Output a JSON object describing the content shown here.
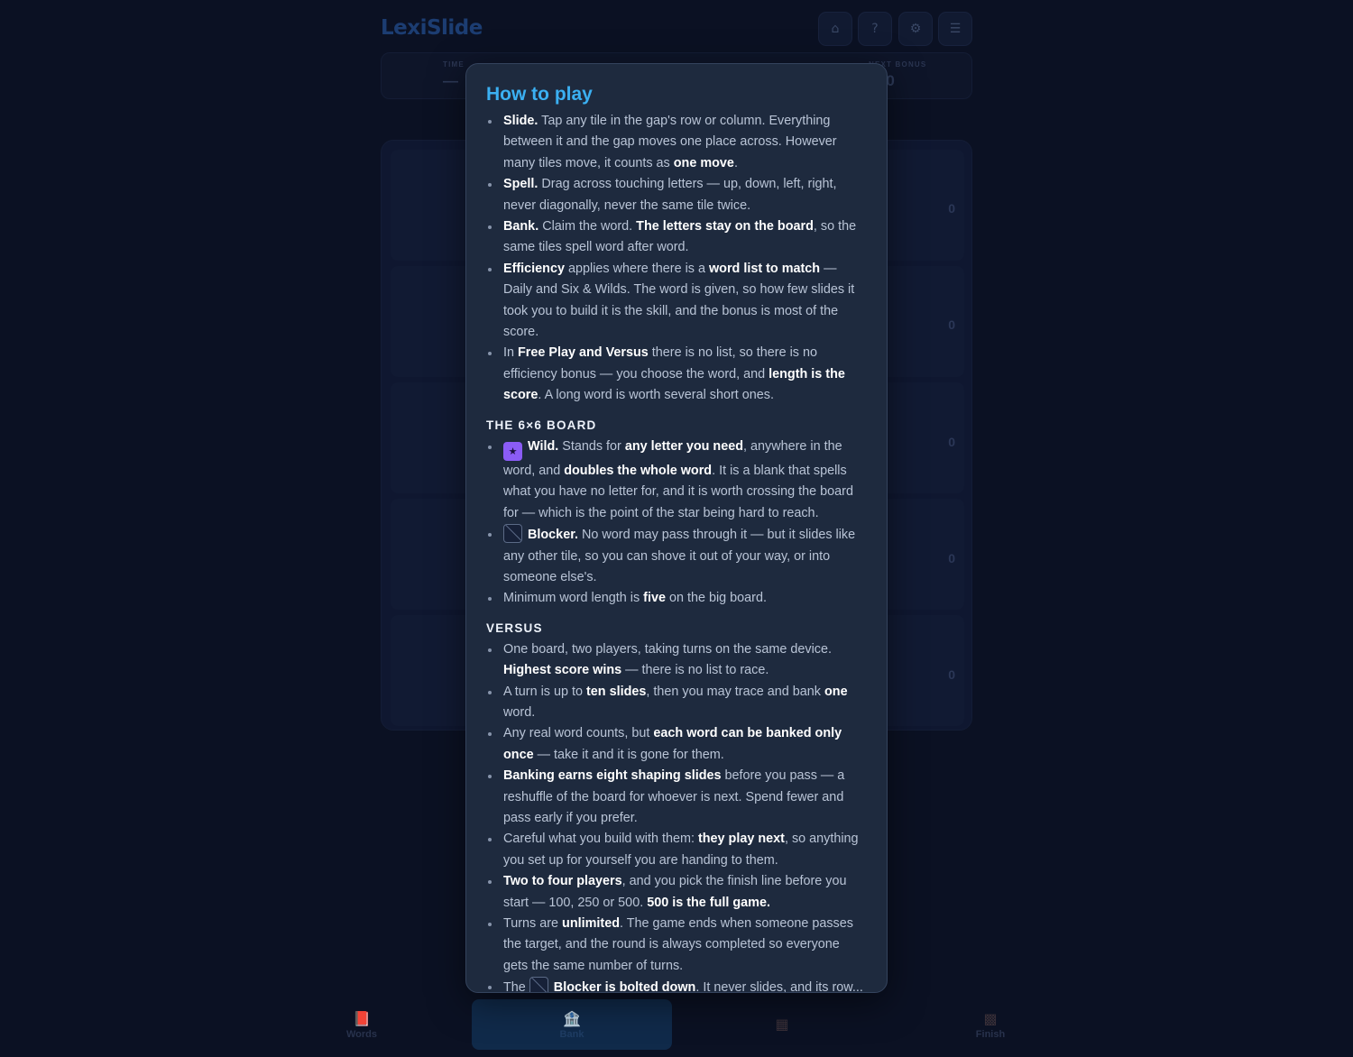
{
  "app": {
    "logo": "LexiSlide",
    "top_buttons": [
      {
        "name": "home-button",
        "icon": "home-icon",
        "glyph": "⌂"
      },
      {
        "name": "help-button",
        "icon": "question-icon",
        "glyph": "?"
      },
      {
        "name": "settings-button",
        "icon": "gear-icon",
        "glyph": "⚙"
      },
      {
        "name": "menu-button",
        "icon": "hamburger-menu-icon",
        "glyph": "☰"
      }
    ],
    "stats": {
      "time_label": "TIME",
      "time_value": "—",
      "next_bonus_label": "NEXT BONUS",
      "next_bonus_value": "+40"
    },
    "row_counts": [
      "0",
      "0",
      "0",
      "0",
      "0"
    ],
    "bottom_nav": [
      {
        "label": "Words",
        "icon": "book-icon",
        "glyph": "📕",
        "active": false
      },
      {
        "label": "Bank",
        "icon": "bank-icon",
        "glyph": "🏦",
        "active": true
      },
      {
        "label": "",
        "icon": "reshuffle-icon",
        "glyph": "▦",
        "active": false
      },
      {
        "label": "Finish",
        "icon": "checkered-flag-icon",
        "glyph": "▩",
        "active": false
      }
    ]
  },
  "modal": {
    "title": "How to play",
    "intro_rules": [
      [
        "Slide.",
        " Tap any tile in the gap's row or column. Everything between it and the gap moves one place across. However many tiles move, it counts as ",
        "one move",
        "."
      ],
      [
        "Spell.",
        " Drag across touching letters — up, down, left, right, never diagonally, never the same tile twice."
      ],
      [
        "Bank.",
        " Claim the word. ",
        "The letters stay on the board",
        ", so the same tiles spell word after word."
      ],
      [
        "Efficiency",
        " applies where there is a ",
        "word list to match",
        " — Daily and Six & Wilds. The word is given, so how few slides it took you to build it is the skill, and the bonus is most of the score."
      ],
      [
        "In ",
        "Free Play and Versus",
        " there is no list, so there is no efficiency bonus — you choose the word, and ",
        "length is the score",
        ". A long word is worth several short ones."
      ]
    ],
    "board_section": {
      "title": "THE 6×6 BOARD",
      "wild": [
        "Wild.",
        " Stands for ",
        "any letter you need",
        ", anywhere in the word, and ",
        "doubles the whole word",
        ". It is a blank that spells what you have no letter for, and it is worth crossing the board for — which is the point of the star being hard to reach."
      ],
      "blocker": [
        "Blocker.",
        " No word may pass through it — but it slides like any other tile, so you can shove it out of your way, or into someone else's."
      ],
      "min_length": [
        "Minimum word length is ",
        "five",
        " on the big board."
      ]
    },
    "versus_section": {
      "title": "VERSUS",
      "rules": [
        [
          "One board, two players, taking turns on the same device. ",
          "Highest score wins",
          " — there is no list to race."
        ],
        [
          "A turn is up to ",
          "ten slides",
          ", then you may trace and bank ",
          "one",
          " word."
        ],
        [
          "Any real word counts, but ",
          "each word can be banked only once",
          " — take it and it is gone for them."
        ],
        [
          "Banking earns eight shaping slides",
          " before you pass — a reshuffle of the board for whoever is next. Spend fewer and pass early if you prefer."
        ],
        [
          "Careful what you build with them: ",
          "they play next",
          ", so anything you set up for yourself you are handing to them."
        ],
        [
          "Two to four players",
          ", and you pick the finish line before you start — 100, 250 or 500. ",
          "500 is the full game."
        ],
        [
          "Turns are ",
          "unlimited",
          ". The game ends when someone passes the target, and the round is always completed so everyone gets the same number of turns."
        ],
        [
          "The ",
          "Blocker is bolted down",
          ". It never slides, and its row..."
        ]
      ]
    }
  }
}
